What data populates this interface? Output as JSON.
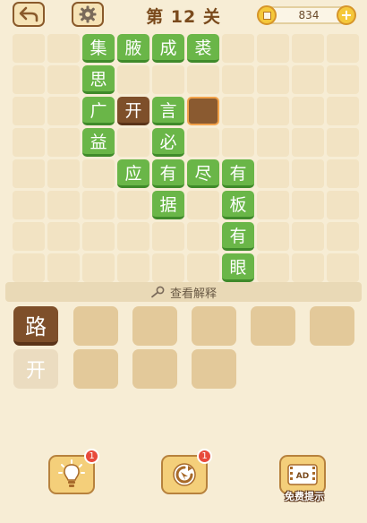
{
  "header": {
    "level_label": "第 12 关",
    "coins": "834",
    "plus": "+"
  },
  "board": {
    "cols": 10,
    "rows": 7,
    "tiles": [
      {
        "r": 0,
        "c": 2,
        "t": "集",
        "s": "g"
      },
      {
        "r": 0,
        "c": 3,
        "t": "腋",
        "s": "g"
      },
      {
        "r": 0,
        "c": 4,
        "t": "成",
        "s": "g"
      },
      {
        "r": 0,
        "c": 5,
        "t": "裘",
        "s": "g"
      },
      {
        "r": 1,
        "c": 2,
        "t": "思",
        "s": "g"
      },
      {
        "r": 2,
        "c": 2,
        "t": "广",
        "s": "g"
      },
      {
        "r": 2,
        "c": 3,
        "t": "开",
        "s": "b"
      },
      {
        "r": 2,
        "c": 4,
        "t": "言",
        "s": "g"
      },
      {
        "r": 2,
        "c": 5,
        "t": "",
        "s": "s"
      },
      {
        "r": 3,
        "c": 2,
        "t": "益",
        "s": "g"
      },
      {
        "r": 3,
        "c": 4,
        "t": "必",
        "s": "g"
      },
      {
        "r": 4,
        "c": 3,
        "t": "应",
        "s": "g"
      },
      {
        "r": 4,
        "c": 4,
        "t": "有",
        "s": "g"
      },
      {
        "r": 4,
        "c": 5,
        "t": "尽",
        "s": "g"
      },
      {
        "r": 4,
        "c": 6,
        "t": "有",
        "s": "g"
      },
      {
        "r": 5,
        "c": 4,
        "t": "据",
        "s": "g"
      },
      {
        "r": 5,
        "c": 6,
        "t": "板",
        "s": "g"
      },
      {
        "r": 6,
        "c": 6,
        "t": "有",
        "s": "g"
      },
      {
        "r": 7,
        "c": 6,
        "t": "眼",
        "s": "g"
      }
    ]
  },
  "hint_bar": {
    "label": "查看解释"
  },
  "choices": [
    {
      "text": "路",
      "state": "word"
    },
    {
      "text": "",
      "state": "empty"
    },
    {
      "text": "",
      "state": "empty"
    },
    {
      "text": "",
      "state": "empty"
    },
    {
      "text": "",
      "state": "empty"
    },
    {
      "text": "",
      "state": "empty"
    },
    {
      "text": "开",
      "state": "used"
    },
    {
      "text": "",
      "state": "empty"
    },
    {
      "text": "",
      "state": "empty"
    },
    {
      "text": "",
      "state": "empty"
    }
  ],
  "powerups": {
    "hint_badge": "1",
    "refresh_badge": "1",
    "ad_label": "免费提示",
    "ad_icon_text": "AD"
  },
  "icons": [
    "back-arrow-icon",
    "gear-icon",
    "coin-icon",
    "plus-icon",
    "magnifier-icon",
    "lightbulb-icon",
    "refresh-icon",
    "ad-video-icon"
  ]
}
